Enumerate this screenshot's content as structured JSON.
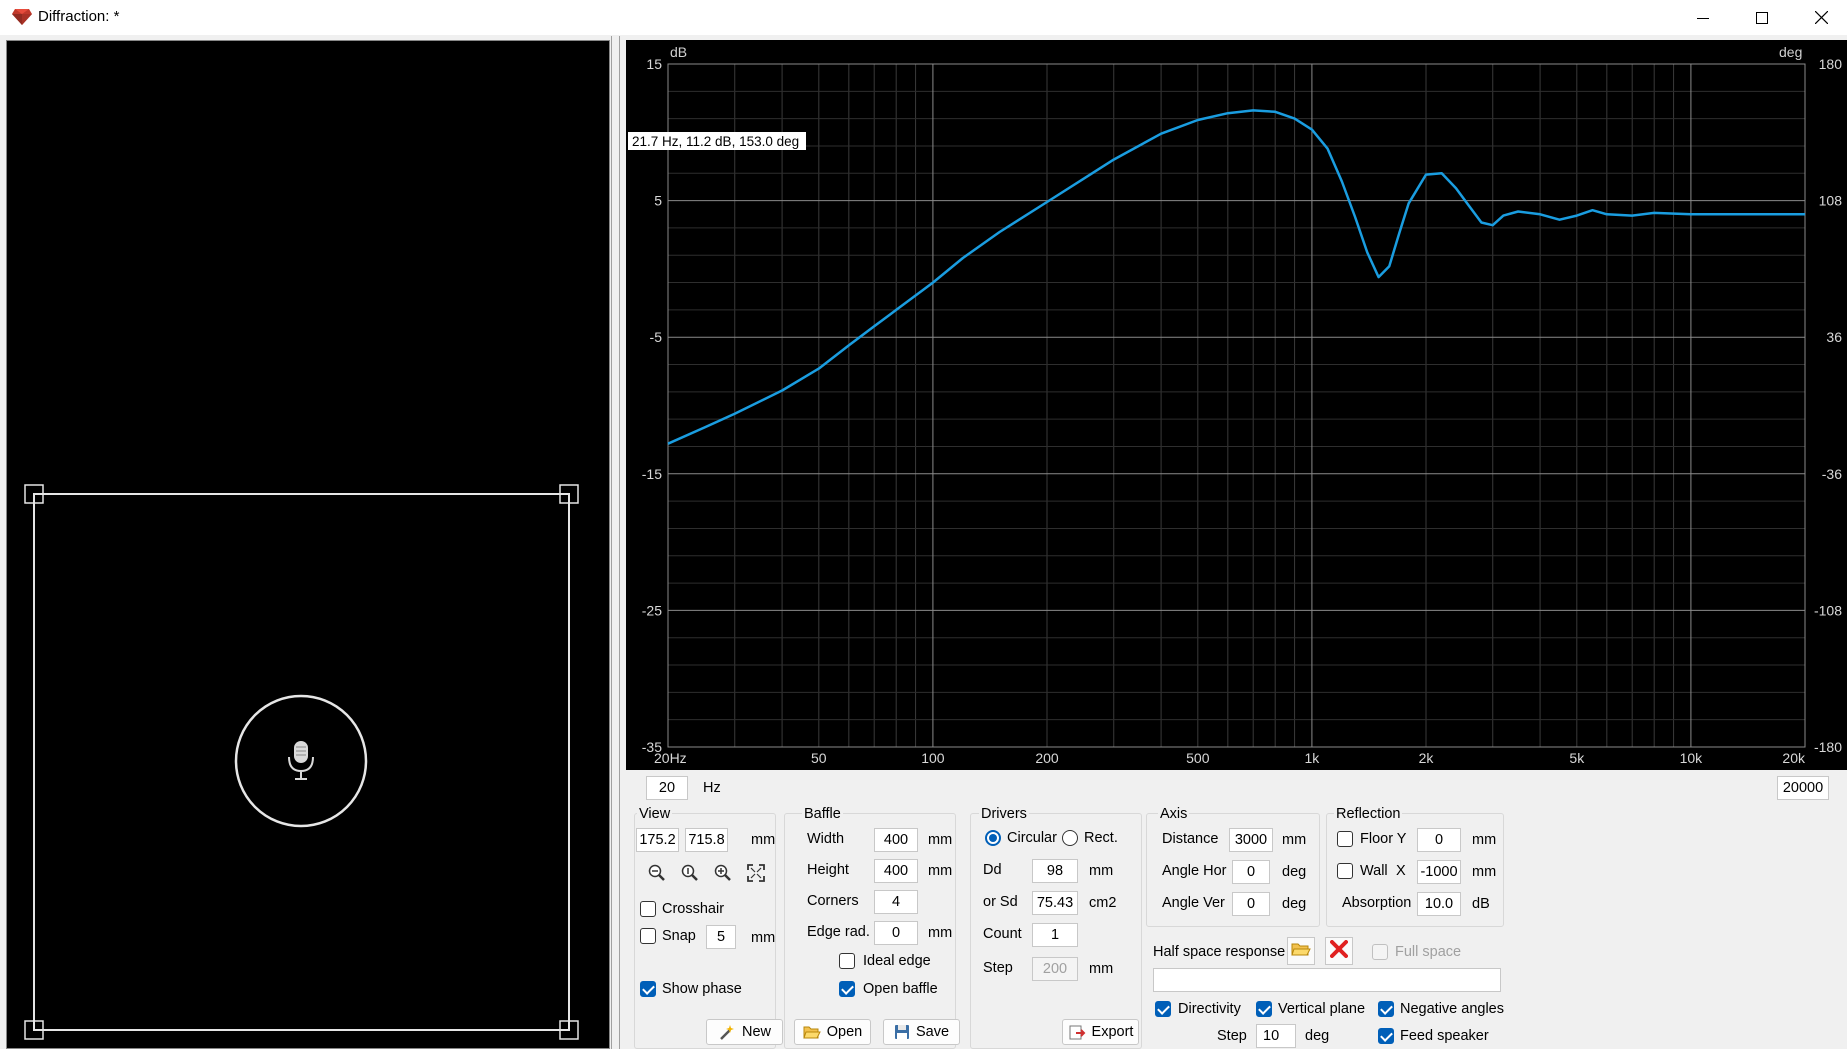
{
  "window": {
    "title": "Diffraction: *",
    "icons": {
      "app": "ruby-gem-icon",
      "minimize": "minimize-icon",
      "maximize": "maximize-icon",
      "close": "close-icon"
    }
  },
  "left_view": {
    "mic_icon": "microphone-icon"
  },
  "graph": {
    "readout": "21.7 Hz, 11.2 dB, 153.0 deg",
    "left_unit": "dB",
    "right_unit": "deg",
    "left_ticks": [
      "15",
      "5",
      "-5",
      "-15",
      "-25",
      "-35"
    ],
    "right_ticks": [
      "180",
      "108",
      "36",
      "-36",
      "-108",
      "-180"
    ],
    "x_ticks": [
      "20Hz",
      "50",
      "100",
      "200",
      "500",
      "1k",
      "2k",
      "5k",
      "10k",
      "20k"
    ],
    "line_color": "#1a9de0"
  },
  "chart_data": {
    "type": "line",
    "x_scale": "log",
    "xlim": [
      20,
      20000
    ],
    "ylim": [
      -35,
      15
    ],
    "y2lim": [
      -180,
      180
    ],
    "series": [
      {
        "x": [
          20,
          25,
          30,
          40,
          50,
          60,
          70,
          80,
          100,
          120,
          150,
          200,
          250,
          300,
          400,
          500,
          600,
          700,
          800,
          900,
          1000,
          1100,
          1200,
          1300,
          1400,
          1500,
          1600,
          1700,
          1800,
          2000,
          2200,
          2400,
          2600,
          2800,
          3000,
          3200,
          3500,
          4000,
          4500,
          5000,
          5500,
          6000,
          7000,
          8000,
          10000,
          12000,
          15000,
          20000
        ],
        "values": [
          -12.8,
          -11.6,
          -10.6,
          -8.9,
          -7.3,
          -5.6,
          -4.2,
          -3.0,
          -1.0,
          0.8,
          2.7,
          4.9,
          6.6,
          8.0,
          9.9,
          10.9,
          11.4,
          11.6,
          11.5,
          11.0,
          10.2,
          8.8,
          6.4,
          3.8,
          1.2,
          -0.6,
          0.2,
          2.6,
          4.8,
          6.9,
          7.0,
          5.9,
          4.6,
          3.4,
          3.2,
          3.9,
          4.2,
          4.0,
          3.6,
          3.9,
          4.3,
          4.0,
          3.9,
          4.1,
          4.0,
          4.0,
          4.0,
          4.0
        ]
      }
    ]
  },
  "freq_range": {
    "min": "20",
    "unit": "Hz",
    "max": "20000"
  },
  "view": {
    "title": "View",
    "x": "175.2",
    "y": "715.8",
    "unit": "mm",
    "zoom_icons": [
      "zoom-out-icon",
      "zoom-fit-height-icon",
      "zoom-in-icon",
      "fit-to-window-icon"
    ],
    "crosshair_label": "Crosshair",
    "crosshair_checked": false,
    "snap_label": "Snap",
    "snap_checked": false,
    "snap_value": "5",
    "snap_unit": "mm",
    "show_phase_label": "Show phase",
    "show_phase_checked": true
  },
  "baffle": {
    "title": "Baffle",
    "width_label": "Width",
    "width_value": "400",
    "width_unit": "mm",
    "height_label": "Height",
    "height_value": "400",
    "height_unit": "mm",
    "corners_label": "Corners",
    "corners_value": "4",
    "edge_label": "Edge rad.",
    "edge_value": "0",
    "edge_unit": "mm",
    "ideal_edge_label": "Ideal edge",
    "ideal_edge_checked": false,
    "open_baffle_label": "Open baffle",
    "open_baffle_checked": true
  },
  "drivers": {
    "title": "Drivers",
    "circular_label": "Circular",
    "circular_selected": true,
    "rect_label": "Rect.",
    "rect_selected": false,
    "dd_label": "Dd",
    "dd_value": "98",
    "dd_unit": "mm",
    "sd_label": "or Sd",
    "sd_value": "75.43",
    "sd_unit": "cm2",
    "count_label": "Count",
    "count_value": "1",
    "step_label": "Step",
    "step_value": "200",
    "step_unit": "mm"
  },
  "axis": {
    "title": "Axis",
    "distance_label": "Distance",
    "distance_value": "3000",
    "distance_unit": "mm",
    "angle_hor_label": "Angle Hor",
    "angle_hor_value": "0",
    "angle_hor_unit": "deg",
    "angle_ver_label": "Angle Ver",
    "angle_ver_value": "0",
    "angle_ver_unit": "deg"
  },
  "reflection": {
    "title": "Reflection",
    "floor_label": "Floor Y",
    "floor_checked": false,
    "floor_value": "0",
    "floor_unit": "mm",
    "wall_label": "Wall",
    "wall_axis": "X",
    "wall_checked": false,
    "wall_value": "-1000",
    "wall_unit": "mm",
    "absorption_label": "Absorption",
    "absorption_value": "10.0",
    "absorption_unit": "dB"
  },
  "half_space": {
    "label": "Half space response",
    "open_icon": "open-folder-icon",
    "clear_icon": "red-x-icon",
    "full_space_label": "Full space",
    "full_space_checked": false,
    "path_value": ""
  },
  "options": {
    "directivity_label": "Directivity",
    "directivity_checked": true,
    "vertical_plane_label": "Vertical plane",
    "vertical_plane_checked": true,
    "negative_angles_label": "Negative angles",
    "negative_angles_checked": true,
    "feed_speaker_label": "Feed speaker",
    "feed_speaker_checked": true,
    "step_label": "Step",
    "step_value": "10",
    "step_unit": "deg"
  },
  "buttons": {
    "new_label": "New",
    "new_icon": "magic-wand-icon",
    "open_label": "Open",
    "open_icon": "open-folder-icon",
    "save_label": "Save",
    "save_icon": "floppy-disk-icon",
    "export_label": "Export",
    "export_icon": "export-icon"
  }
}
